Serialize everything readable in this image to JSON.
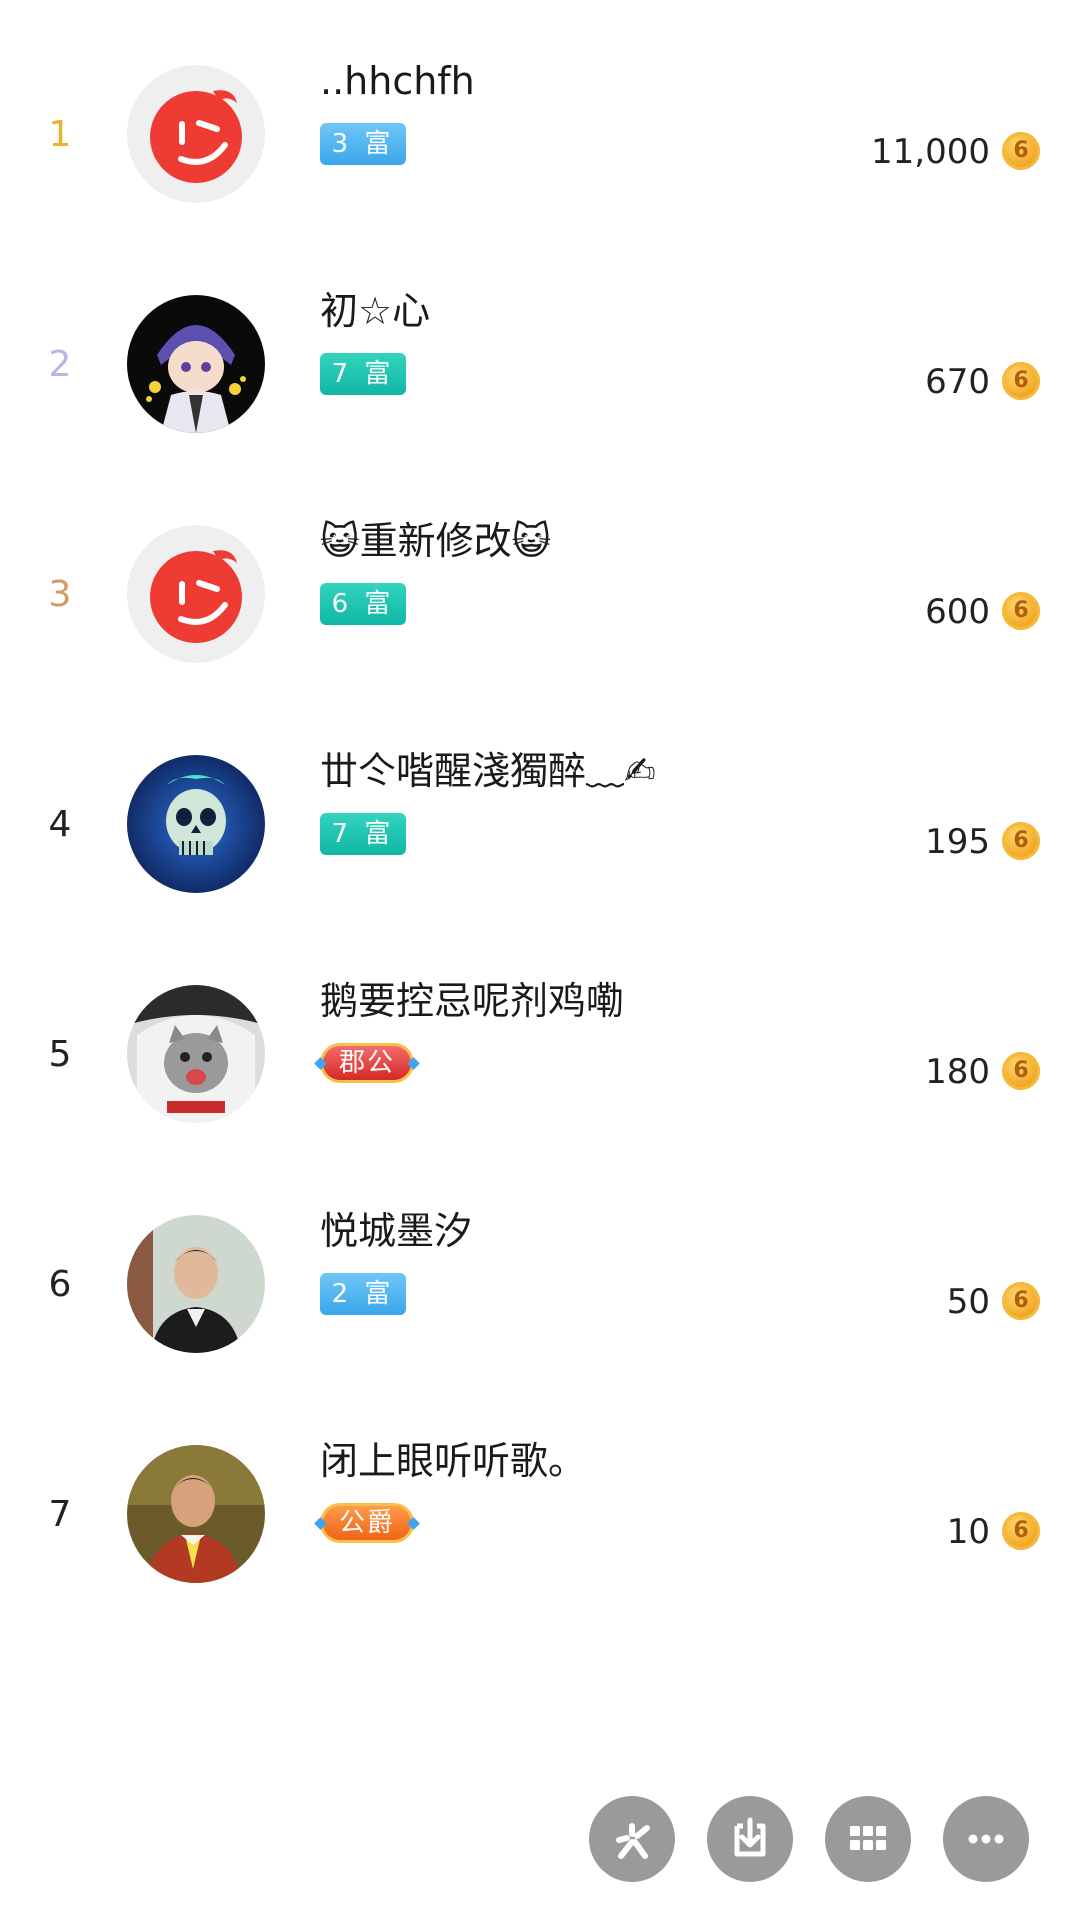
{
  "ranking": [
    {
      "rank": "1",
      "rank_color": "#e8b528",
      "name": "..hhchfh",
      "badge": "3 富",
      "badge_style": "blue",
      "amount": "11,000",
      "avatar": "red-wink-logo"
    },
    {
      "rank": "2",
      "rank_color": "#b7b7e6",
      "name": "初☆心",
      "badge": "7 富",
      "badge_style": "teal",
      "amount": "670",
      "avatar": "anime-character"
    },
    {
      "rank": "3",
      "rank_color": "#d09a62",
      "name": "😺重新修改😺",
      "badge": "6 富",
      "badge_style": "teal",
      "amount": "600",
      "avatar": "red-wink-logo"
    },
    {
      "rank": "4",
      "rank_color": "#222222",
      "name": "丗仒喈醒淺獨醉﹏✍",
      "badge": "7 富",
      "badge_style": "teal",
      "amount": "195",
      "avatar": "blue-skull"
    },
    {
      "rank": "5",
      "rank_color": "#222222",
      "name": "鹅要控忌呢剂鸡嘞",
      "badge": "郡公",
      "badge_style": "noble-red",
      "amount": "180",
      "avatar": "cat-hoodie"
    },
    {
      "rank": "6",
      "rank_color": "#222222",
      "name": "悦城墨汐",
      "badge": "2 富",
      "badge_style": "blue",
      "amount": "50",
      "avatar": "man-portrait"
    },
    {
      "rank": "7",
      "rank_color": "#222222",
      "name": "闭上眼听听歌。",
      "badge": "公爵",
      "badge_style": "noble-orange",
      "amount": "10",
      "avatar": "man-suit"
    }
  ],
  "coin_glyph": "6",
  "toolbar": [
    {
      "name": "share-spark-icon"
    },
    {
      "name": "download-icon"
    },
    {
      "name": "grid-icon"
    },
    {
      "name": "more-icon"
    }
  ],
  "colors": {
    "badge_blue": "#3aa7ea",
    "badge_teal": "#10b7a4",
    "coin": "#f0a21f",
    "fab": "#9a9a9a"
  }
}
